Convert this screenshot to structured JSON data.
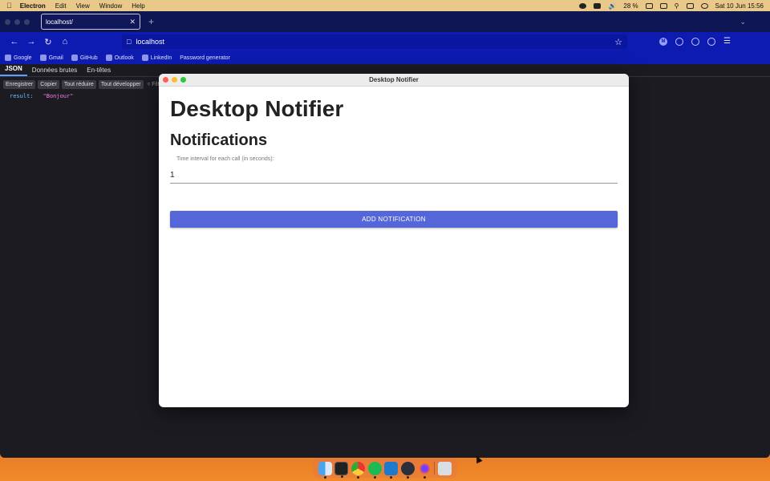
{
  "menubar": {
    "app": "Electron",
    "items": [
      "Edit",
      "View",
      "Window",
      "Help"
    ],
    "battery": "28 %",
    "datetime": "Sat 10 Jun  15:56"
  },
  "browser": {
    "tab_title": "localhost/",
    "url": "localhost",
    "bookmarks": [
      "Google",
      "Gmail",
      "GitHub",
      "Outlook",
      "LinkedIn",
      "Password generator"
    ]
  },
  "jsonviewer": {
    "tabs": [
      "JSON",
      "Données brutes",
      "En-têtes"
    ],
    "toolbar": [
      "Enregistrer",
      "Copier",
      "Tout réduire",
      "Tout développer"
    ],
    "filter": "Filtrer",
    "rows": [
      {
        "key": "result:",
        "value": "\"Bonjour\""
      }
    ]
  },
  "app": {
    "window_title": "Desktop Notifier",
    "heading": "Desktop Notifier",
    "subheading": "Notifications",
    "interval_label": "Time interval for each call (in seconds):",
    "interval_value": "1",
    "add_button": "ADD NOTIFICATION"
  },
  "dock": {
    "icons": [
      "finder-icon",
      "terminal-icon",
      "chrome-icon",
      "spotify-icon",
      "vscode-icon",
      "electron-icon",
      "firefox-icon",
      "trash-icon"
    ]
  }
}
